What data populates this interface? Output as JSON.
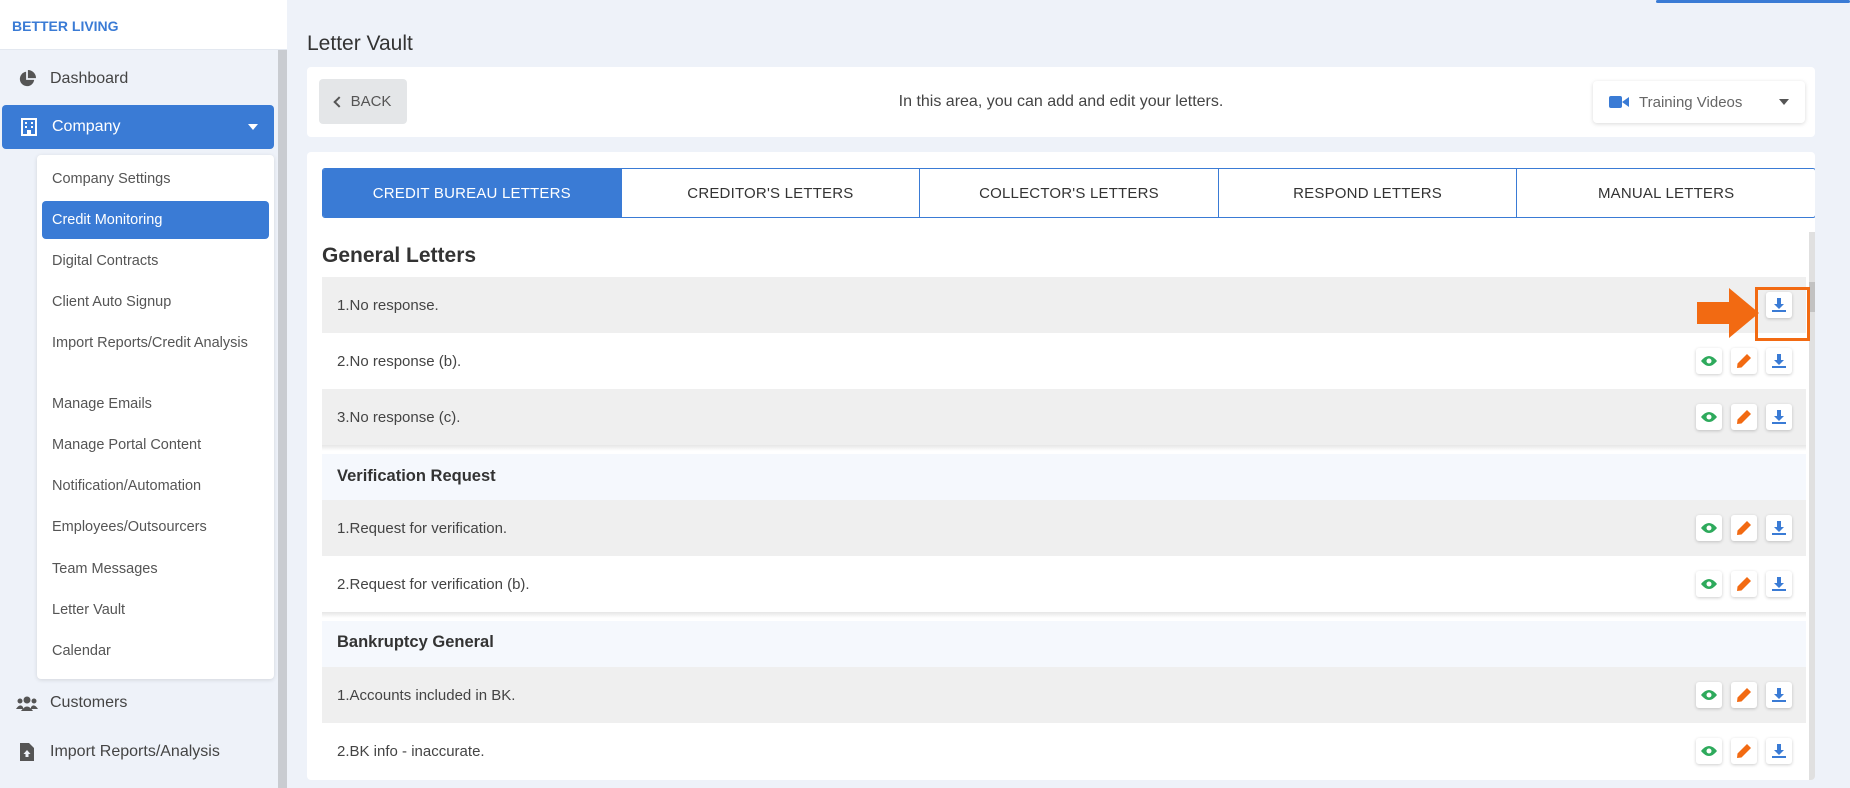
{
  "brand": "BETTER LIVING",
  "page_title": "Letter Vault",
  "sidebar": {
    "items": [
      {
        "label": "Dashboard",
        "icon": "pie-chart-icon"
      },
      {
        "label": "Company",
        "icon": "building-icon"
      },
      {
        "label": "Customers",
        "icon": "users-icon"
      },
      {
        "label": "Import Reports/Analysis",
        "icon": "file-upload-icon"
      }
    ],
    "submenu": [
      "Company Settings",
      "Credit Monitoring",
      "Digital Contracts",
      "Client Auto Signup",
      "Import Reports/Credit Analysis",
      "Manage Emails",
      "Manage Portal Content",
      "Notification/Automation",
      "Employees/Outsourcers",
      "Team Messages",
      "Letter Vault",
      "Calendar"
    ],
    "active_submenu": "Credit Monitoring"
  },
  "header": {
    "back_label": "BACK",
    "description": "In this area, you can add and edit your letters.",
    "videos_label": "Training Videos"
  },
  "tabs": [
    "CREDIT BUREAU LETTERS",
    "CREDITOR'S LETTERS",
    "COLLECTOR'S LETTERS",
    "RESPOND LETTERS",
    "MANUAL LETTERS"
  ],
  "active_tab": "CREDIT BUREAU LETTERS",
  "groups": [
    {
      "title": "General Letters",
      "letters": [
        "1.No response.",
        "2.No response (b).",
        "3.No response (c)."
      ]
    },
    {
      "title": "Verification Request",
      "letters": [
        "1.Request for verification.",
        "2.Request for verification (b)."
      ]
    },
    {
      "title": "Bankruptcy General",
      "letters": [
        "1.Accounts included in BK.",
        "2.BK info - inaccurate."
      ]
    }
  ],
  "colors": {
    "accent": "#3a7bd5",
    "view": "#2eaa5c",
    "edit": "#f26a12",
    "highlight": "#f26a12"
  }
}
